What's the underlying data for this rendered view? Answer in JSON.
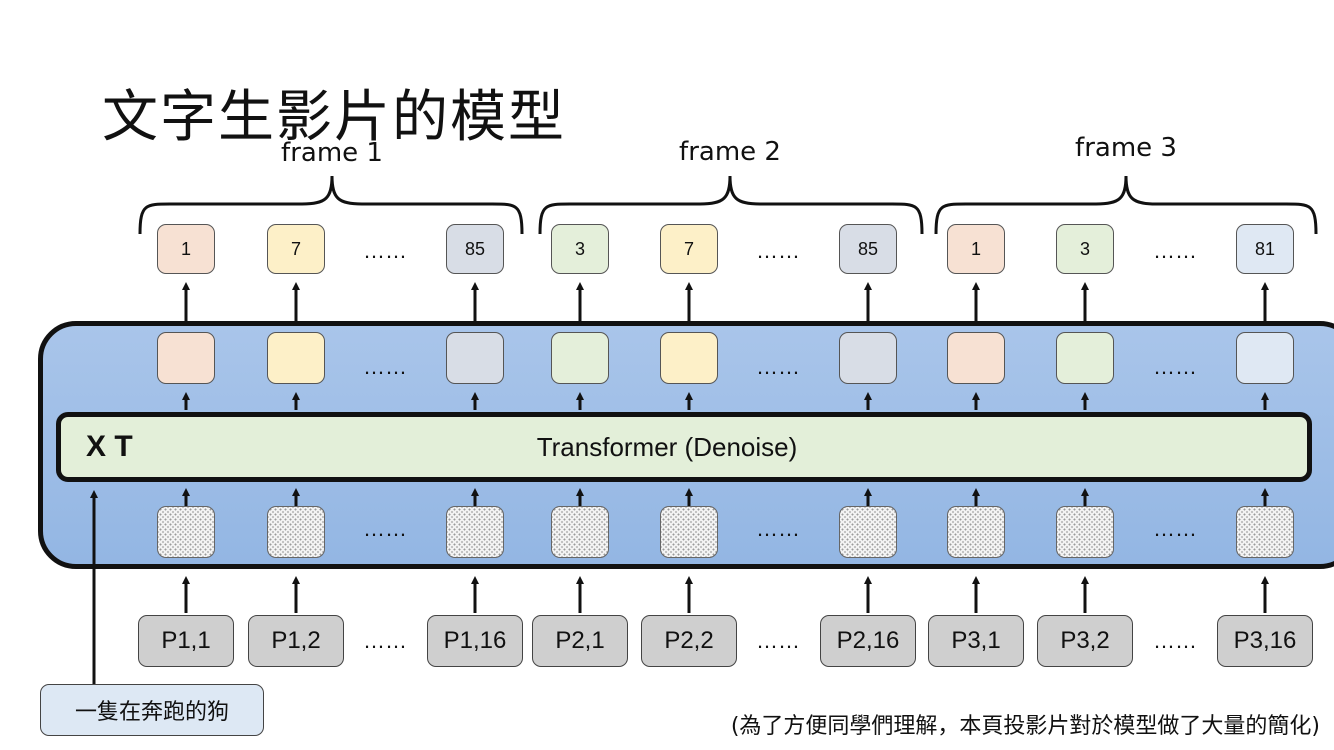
{
  "title": "文字生影片的模型",
  "frames": [
    {
      "label": "frame 1",
      "tokens": [
        "1",
        "7",
        "85"
      ],
      "colors": [
        "#f7e1d3",
        "#fdf0c8",
        "#d8dde6"
      ],
      "patches": [
        "P1,1",
        "P1,2",
        "P1,16"
      ]
    },
    {
      "label": "frame 2",
      "tokens": [
        "3",
        "7",
        "85"
      ],
      "colors": [
        "#e4efda",
        "#fdf0c8",
        "#d8dde6"
      ],
      "patches": [
        "P2,1",
        "P2,2",
        "P2,16"
      ]
    },
    {
      "label": "frame 3",
      "tokens": [
        "1",
        "3",
        "81"
      ],
      "colors": [
        "#f7e1d3",
        "#e4efda",
        "#dfe8f3"
      ],
      "patches": [
        "P3,1",
        "P3,2",
        "P3,16"
      ]
    }
  ],
  "ellipsis": "……",
  "transformer": {
    "label": "Transformer (Denoise)",
    "xt_label": "X T"
  },
  "prompt": "一隻在奔跑的狗",
  "note": "(為了方便同學們理解，本頁投影片對於模型做了大量的簡化)"
}
